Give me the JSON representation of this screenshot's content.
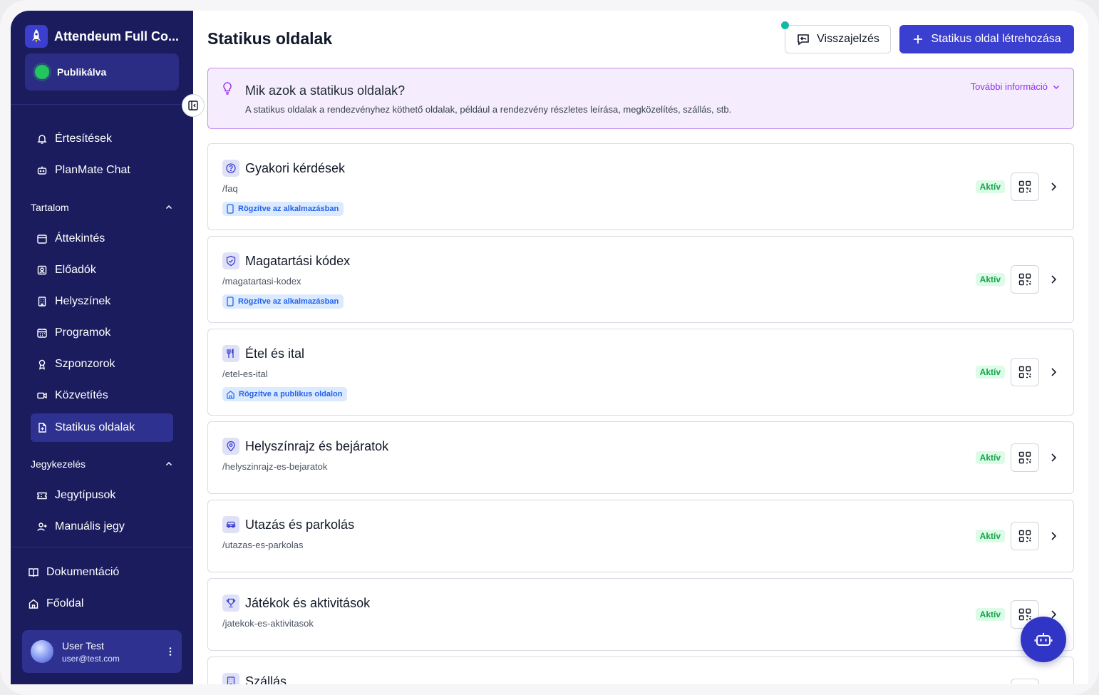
{
  "app": {
    "title": "Attendeum Full Co...",
    "publish_status": "Publikálva"
  },
  "sidebar": {
    "notifications": "Értesítések",
    "chat": "PlanMate Chat",
    "section_content": "Tartalom",
    "content_items": [
      "Áttekintés",
      "Előadók",
      "Helyszínek",
      "Programok",
      "Szponzorok",
      "Közvetítés",
      "Statikus oldalak"
    ],
    "section_tickets": "Jegykezelés",
    "ticket_items": [
      "Jegytípusok",
      "Manuális jegy"
    ],
    "docs": "Dokumentáció",
    "home": "Főoldal",
    "user": {
      "name": "User Test",
      "email": "user@test.com"
    }
  },
  "header": {
    "title": "Statikus oldalak",
    "feedback_label": "Visszajelzés",
    "create_label": "Statikus oldal létrehozása"
  },
  "info": {
    "title": "Mik azok a statikus oldalak?",
    "description": "A statikus oldalak a rendezvényhez köthető oldalak, például a rendezvény részletes leírása, megközelítés, szállás, stb.",
    "more_label": "További információ"
  },
  "pages": [
    {
      "icon": "question-circle-icon",
      "title": "Gyakori kérdések",
      "slug": "/faq",
      "pin": "Rögzítve az alkalmazásban",
      "pin_icon": "phone-icon",
      "status": "Aktív"
    },
    {
      "icon": "shield-check-icon",
      "title": "Magatartási kódex",
      "slug": "/magatartasi-kodex",
      "pin": "Rögzítve az alkalmazásban",
      "pin_icon": "phone-icon",
      "status": "Aktív"
    },
    {
      "icon": "utensils-icon",
      "title": "Étel és ital",
      "slug": "/etel-es-ital",
      "pin": "Rögzítve a publikus oldalon",
      "pin_icon": "home-icon",
      "status": "Aktív"
    },
    {
      "icon": "map-pin-icon",
      "title": "Helyszínrajz és bejáratok",
      "slug": "/helyszinrajz-es-bejaratok",
      "status": "Aktív"
    },
    {
      "icon": "car-icon",
      "title": "Utazás és parkolás",
      "slug": "/utazas-es-parkolas",
      "status": "Aktív"
    },
    {
      "icon": "trophy-icon",
      "title": "Játékok és aktivitások",
      "slug": "/jatekok-es-aktivitasok",
      "status": "Aktív"
    },
    {
      "icon": "building-icon",
      "title": "Szállás"
    }
  ],
  "colors": {
    "sidebar_bg": "#1b1c5e",
    "accent": "#3b3fd0",
    "active_green": "#16a34a",
    "info_purple": "#9333ea"
  }
}
